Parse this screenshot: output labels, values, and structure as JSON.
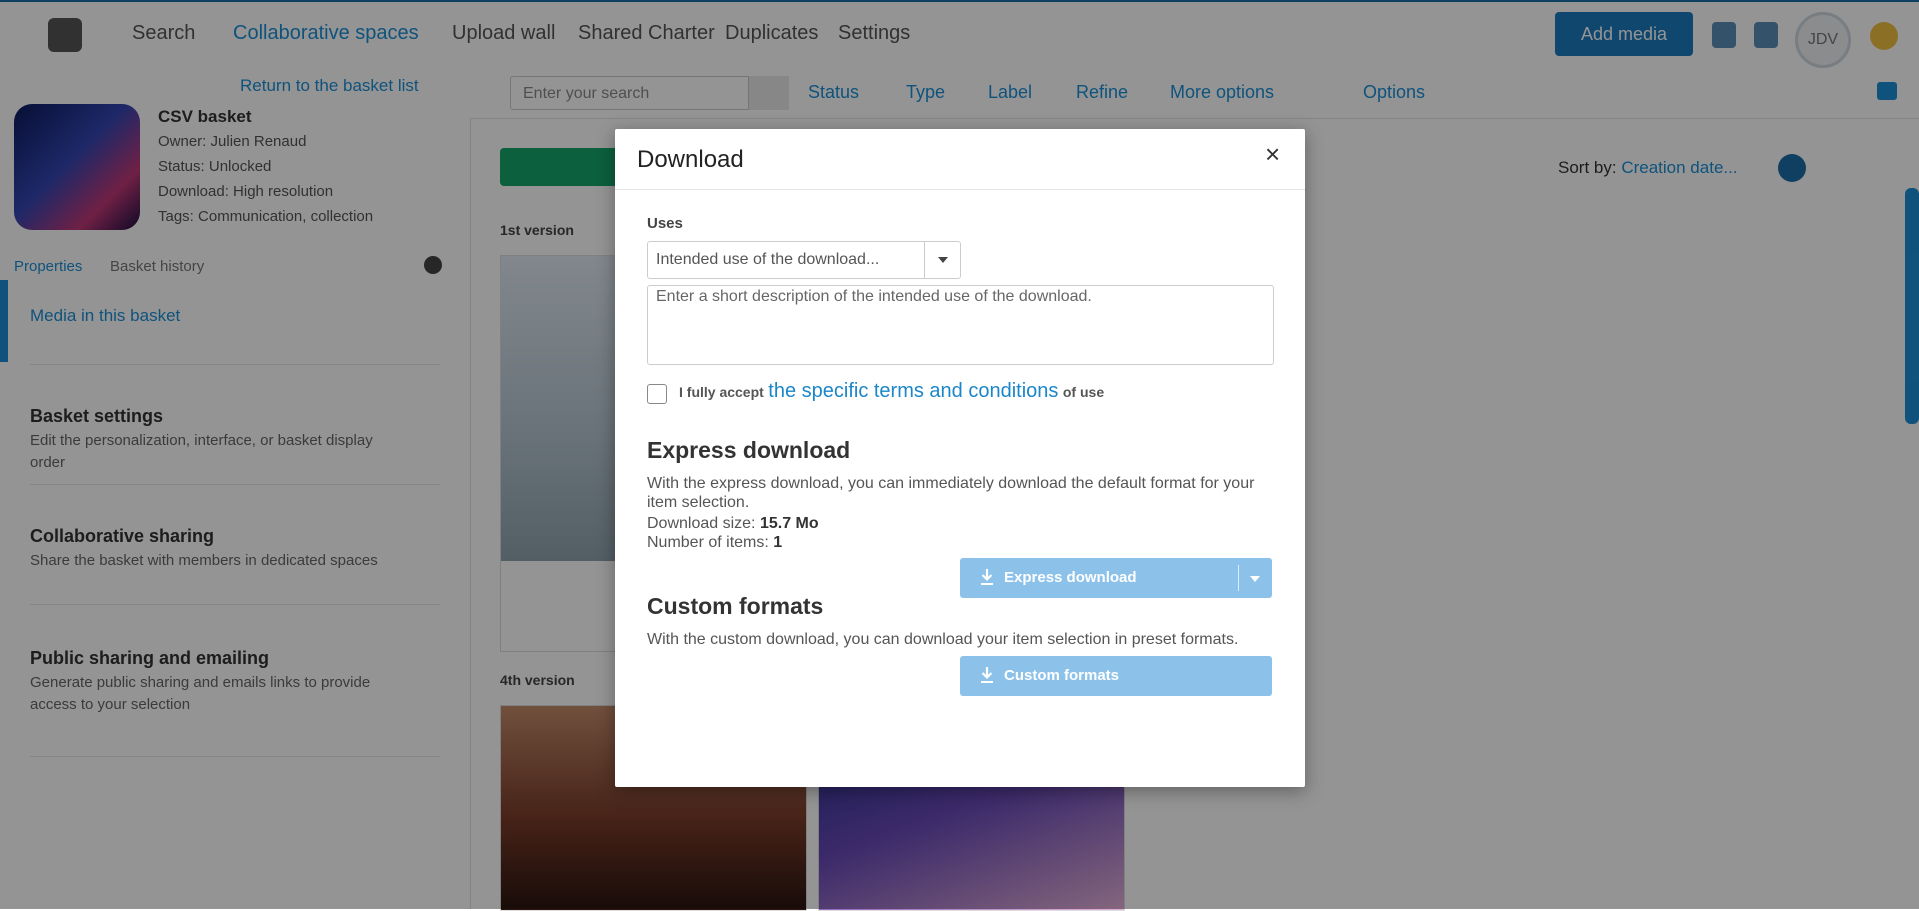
{
  "background": {
    "nav": {
      "search": "Search",
      "collab": "Collaborative spaces",
      "upload": "Upload wall",
      "shared": "Shared Charter",
      "duplicates": "Duplicates",
      "settings": "Settings"
    },
    "add_media": "Add media",
    "avatar_initials": "JDV",
    "sidebar": {
      "return_link": "Return to the basket list",
      "basket_name": "CSV basket",
      "owner": "Owner: Julien Renaud",
      "status": "Status: Unlocked",
      "download": "Download: High resolution",
      "tags": "Tags: Communication, collection",
      "tab_properties": "Properties",
      "tab_history": "Basket history",
      "active_item": "Media in this basket",
      "basket_settings_title": "Basket settings",
      "basket_settings_desc": "Edit the personalization, interface, or basket display order",
      "collab_title": "Collaborative sharing",
      "collab_desc": "Share the basket with members in dedicated spaces",
      "public_title": "Public sharing and emailing",
      "public_desc": "Generate public sharing and emails links to provide access to your selection"
    },
    "filters": {
      "search_placeholder": "Enter your search",
      "status": "Status",
      "type": "Type",
      "label": "Label",
      "refine": "Refine",
      "more": "More options",
      "options": "Options"
    },
    "sort_label": "Sort by:",
    "sort_value": "Creation date...",
    "section1": "1st version",
    "section2": "4th version"
  },
  "modal": {
    "title": "Download",
    "close": "×",
    "uses_label": "Uses",
    "uses_placeholder": "Intended use of the download...",
    "description_placeholder": "Enter a short description of the intended use of the download.",
    "terms_prefix": "I fully accept",
    "terms_link": "the specific terms and conditions",
    "terms_suffix": "of use",
    "express": {
      "title": "Express download",
      "desc": "With the express download, you can immediately download the default format for your item selection.",
      "size_label": "Download size:",
      "size_value": "15.7 Mo",
      "items_label": "Number of items:",
      "items_value": "1",
      "button": "Express download"
    },
    "custom": {
      "title": "Custom formats",
      "desc": "With the custom download, you can download your item selection in preset formats.",
      "button": "Custom formats"
    }
  },
  "colors": {
    "accent": "#1b87c9",
    "button_disabled": "#8cc2ea",
    "overlay": "rgba(0,0,0,0.42)"
  }
}
